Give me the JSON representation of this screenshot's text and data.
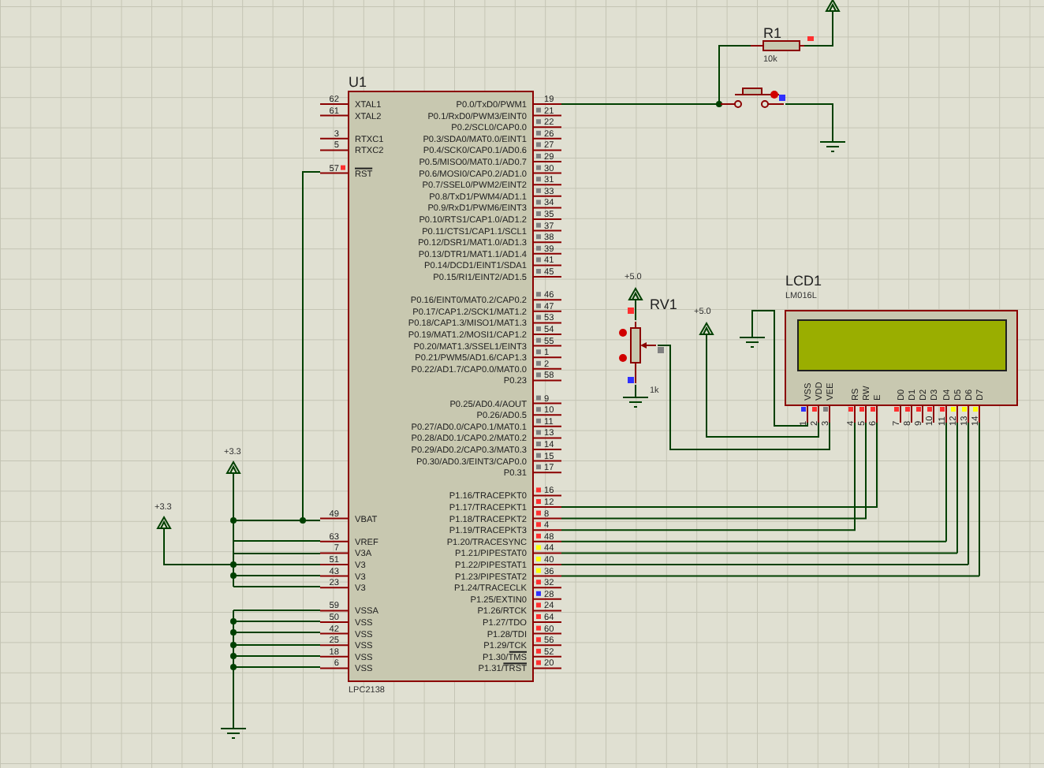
{
  "schematic": {
    "u1": {
      "reference": "U1",
      "part": "LPC2138",
      "left_pins": [
        {
          "name": "XTAL1",
          "number": "62"
        },
        {
          "name": "XTAL2",
          "number": "61"
        },
        {
          "name": "RTXC1",
          "number": "3"
        },
        {
          "name": "RTXC2",
          "number": "5"
        },
        {
          "name": "RST",
          "number": "57",
          "active_low": true,
          "color": "#ff3030"
        },
        {
          "name": "VBAT",
          "number": "49"
        },
        {
          "name": "VREF",
          "number": "63"
        },
        {
          "name": "V3A",
          "number": "7"
        },
        {
          "name": "V3",
          "number": "51"
        },
        {
          "name": "V3",
          "number": "43"
        },
        {
          "name": "V3",
          "number": "23"
        },
        {
          "name": "VSSA",
          "number": "59"
        },
        {
          "name": "VSS",
          "number": "50"
        },
        {
          "name": "VSS",
          "number": "42"
        },
        {
          "name": "VSS",
          "number": "25"
        },
        {
          "name": "VSS",
          "number": "18"
        },
        {
          "name": "VSS",
          "number": "6"
        }
      ],
      "right_pins": [
        {
          "name": "P0.0/TxD0/PWM1",
          "number": "19"
        },
        {
          "name": "P0.1/RxD0/PWM3/EINT0",
          "number": "21",
          "color": "#808080"
        },
        {
          "name": "P0.2/SCL0/CAP0.0",
          "number": "22",
          "color": "#808080"
        },
        {
          "name": "P0.3/SDA0/MAT0.0/EINT1",
          "number": "26",
          "color": "#808080"
        },
        {
          "name": "P0.4/SCK0/CAP0.1/AD0.6",
          "number": "27",
          "color": "#808080"
        },
        {
          "name": "P0.5/MISO0/MAT0.1/AD0.7",
          "number": "29",
          "color": "#808080"
        },
        {
          "name": "P0.6/MOSI0/CAP0.2/AD1.0",
          "number": "30",
          "color": "#808080"
        },
        {
          "name": "P0.7/SSEL0/PWM2/EINT2",
          "number": "31",
          "color": "#808080"
        },
        {
          "name": "P0.8/TxD1/PWM4/AD1.1",
          "number": "33",
          "color": "#808080"
        },
        {
          "name": "P0.9/RxD1/PWM6/EINT3",
          "number": "34",
          "color": "#808080"
        },
        {
          "name": "P0.10/RTS1/CAP1.0/AD1.2",
          "number": "35",
          "color": "#808080"
        },
        {
          "name": "P0.11/CTS1/CAP1.1/SCL1",
          "number": "37",
          "color": "#808080"
        },
        {
          "name": "P0.12/DSR1/MAT1.0/AD1.3",
          "number": "38",
          "color": "#808080"
        },
        {
          "name": "P0.13/DTR1/MAT1.1/AD1.4",
          "number": "39",
          "color": "#808080"
        },
        {
          "name": "P0.14/DCD1/EINT1/SDA1",
          "number": "41",
          "color": "#808080"
        },
        {
          "name": "P0.15/RI1/EINT2/AD1.5",
          "number": "45",
          "color": "#808080"
        },
        {
          "name": "P0.16/EINT0/MAT0.2/CAP0.2",
          "number": "46",
          "color": "#808080"
        },
        {
          "name": "P0.17/CAP1.2/SCK1/MAT1.2",
          "number": "47",
          "color": "#808080"
        },
        {
          "name": "P0.18/CAP1.3/MISO1/MAT1.3",
          "number": "53",
          "color": "#808080"
        },
        {
          "name": "P0.19/MAT1.2/MOSI1/CAP1.2",
          "number": "54",
          "color": "#808080"
        },
        {
          "name": "P0.20/MAT1.3/SSEL1/EINT3",
          "number": "55",
          "color": "#808080"
        },
        {
          "name": "P0.21/PWM5/AD1.6/CAP1.3",
          "number": "1",
          "color": "#808080"
        },
        {
          "name": "P0.22/AD1.7/CAP0.0/MAT0.0",
          "number": "2",
          "color": "#808080"
        },
        {
          "name": "P0.23",
          "number": "58",
          "color": "#808080"
        },
        {
          "name": "P0.25/AD0.4/AOUT",
          "number": "9",
          "color": "#808080"
        },
        {
          "name": "P0.26/AD0.5",
          "number": "10",
          "color": "#808080"
        },
        {
          "name": "P0.27/AD0.0/CAP0.1/MAT0.1",
          "number": "11",
          "color": "#808080"
        },
        {
          "name": "P0.28/AD0.1/CAP0.2/MAT0.2",
          "number": "13",
          "color": "#808080"
        },
        {
          "name": "P0.29/AD0.2/CAP0.3/MAT0.3",
          "number": "14",
          "color": "#808080"
        },
        {
          "name": "P0.30/AD0.3/EINT3/CAP0.0",
          "number": "15",
          "color": "#808080"
        },
        {
          "name": "P0.31",
          "number": "17",
          "color": "#808080"
        },
        {
          "name": "P1.16/TRACEPKT0",
          "number": "16",
          "color": "#ff3030"
        },
        {
          "name": "P1.17/TRACEPKT1",
          "number": "12",
          "color": "#ff3030"
        },
        {
          "name": "P1.18/TRACEPKT2",
          "number": "8",
          "color": "#ff3030"
        },
        {
          "name": "P1.19/TRACEPKT3",
          "number": "4",
          "color": "#ff3030"
        },
        {
          "name": "P1.20/TRACESYNC",
          "number": "48",
          "color": "#ff3030"
        },
        {
          "name": "P1.21/PIPESTAT0",
          "number": "44",
          "color": "#ffff00"
        },
        {
          "name": "P1.22/PIPESTAT1",
          "number": "40",
          "color": "#ffff00"
        },
        {
          "name": "P1.23/PIPESTAT2",
          "number": "36",
          "color": "#ffff00"
        },
        {
          "name": "P1.24/TRACECLK",
          "number": "32",
          "color": "#ff3030"
        },
        {
          "name": "P1.25/EXTIN0",
          "number": "28",
          "color": "#3030ff"
        },
        {
          "name": "P1.26/RTCK",
          "number": "24",
          "color": "#ff3030"
        },
        {
          "name": "P1.27/TDO",
          "number": "64",
          "color": "#ff3030"
        },
        {
          "name": "P1.28/TDI",
          "number": "60",
          "color": "#ff3030"
        },
        {
          "name": "P1.29/TCK",
          "number": "56",
          "color": "#ff3030"
        },
        {
          "name": "P1.30/TMS",
          "number": "52",
          "color": "#ff3030",
          "active_low": true
        },
        {
          "name": "P1.31/TRST",
          "number": "20",
          "color": "#ff3030",
          "active_low": true
        }
      ]
    },
    "r1": {
      "reference": "R1",
      "value": "10k"
    },
    "rv1": {
      "reference": "RV1",
      "value": "1k"
    },
    "lcd1": {
      "reference": "LCD1",
      "part": "LM016L",
      "pins": [
        {
          "name": "VSS",
          "number": "1",
          "color": "#3030ff"
        },
        {
          "name": "VDD",
          "number": "2",
          "color": "#ff3030"
        },
        {
          "name": "VEE",
          "number": "3",
          "color": "#808080"
        },
        {
          "name": "RS",
          "number": "4",
          "color": "#ff3030"
        },
        {
          "name": "RW",
          "number": "5",
          "color": "#ff3030"
        },
        {
          "name": "E",
          "number": "6",
          "color": "#ff3030"
        },
        {
          "name": "D0",
          "number": "7",
          "color": "#ff3030"
        },
        {
          "name": "D1",
          "number": "8",
          "color": "#ff3030"
        },
        {
          "name": "D2",
          "number": "9",
          "color": "#ff3030"
        },
        {
          "name": "D3",
          "number": "10",
          "color": "#ff3030"
        },
        {
          "name": "D4",
          "number": "11",
          "color": "#ff3030"
        },
        {
          "name": "D5",
          "number": "12",
          "color": "#ffff00"
        },
        {
          "name": "D6",
          "number": "13",
          "color": "#ffff00"
        },
        {
          "name": "D7",
          "number": "14",
          "color": "#ffff00"
        }
      ]
    },
    "power_terminals": [
      {
        "label": "+5.0"
      },
      {
        "label": "+5.0"
      },
      {
        "label": "+3.3"
      },
      {
        "label": "+3.3"
      }
    ]
  }
}
